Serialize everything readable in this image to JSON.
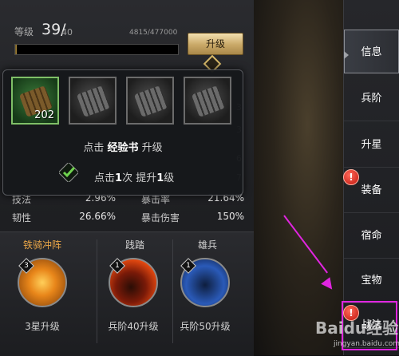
{
  "level": {
    "label": "等级",
    "value": "39/",
    "max": "40",
    "exp": "4815/477000",
    "exp_fraction": 0.0101,
    "upgrade_label": "升级"
  },
  "popup": {
    "book_count": "202",
    "hint1_prefix": "点击 ",
    "hint1_item": "经验书",
    "hint1_suffix": " 升级",
    "hint2_a": "点击",
    "hint2_b": "1",
    "hint2_c": "次 提升",
    "hint2_d": "1",
    "hint2_e": "级"
  },
  "edge_values": [
    "3",
    "3",
    "6",
    "7"
  ],
  "stats": [
    {
      "label": "技法",
      "value": "2.96%",
      "label2": "暴击率",
      "value2": "21.64%"
    },
    {
      "label": "韧性",
      "value": "26.66%",
      "label2": "暴击伤害",
      "value2": "150%"
    }
  ],
  "skills": [
    {
      "name": "铁骑冲阵",
      "level": "3",
      "req": "3星升级",
      "icon": "cavalry-charge-icon"
    },
    {
      "name": "践踏",
      "level": "1",
      "req": "兵阶40升级",
      "icon": "trample-icon"
    },
    {
      "name": "雄兵",
      "level": "1",
      "req": "兵阶50升级",
      "icon": "mighty-troops-icon"
    }
  ],
  "tabs": [
    {
      "label": "信息",
      "active": true
    },
    {
      "label": "兵阶"
    },
    {
      "label": "升星"
    },
    {
      "label": "装备",
      "alert": true
    },
    {
      "label": "宿命"
    },
    {
      "label": "宝物"
    },
    {
      "label": "战法",
      "alert": true
    }
  ],
  "alert_mark": "!",
  "watermark": {
    "text": "Baidu经验",
    "url": "jingyan.baidu.com"
  },
  "colors": {
    "highlight": "#e025e0",
    "skill_gold": "#e9a648",
    "selected_green": "#7fbf67"
  }
}
